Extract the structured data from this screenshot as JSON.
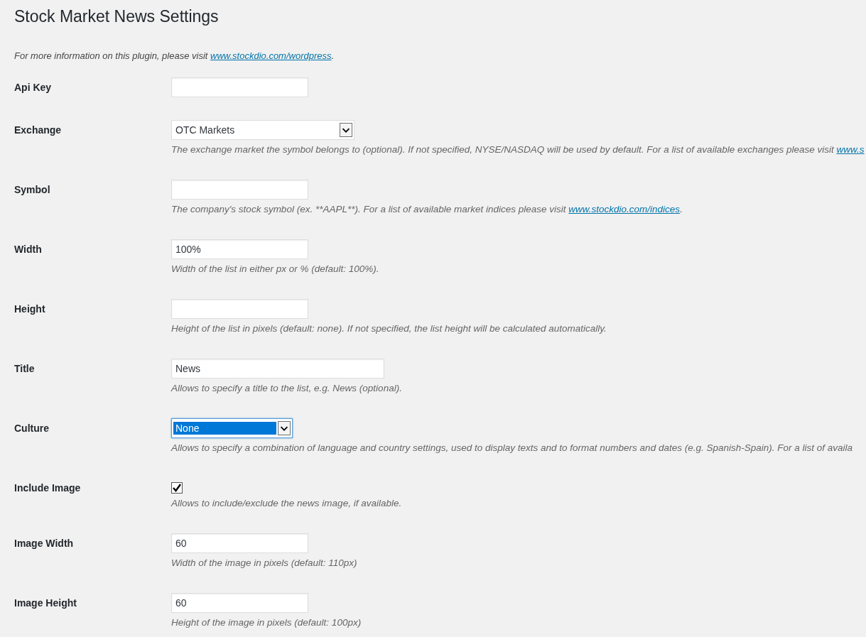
{
  "title": "Stock Market News Settings",
  "intro": {
    "before": "For more information on this plugin, please visit ",
    "link": "www.stockdio.com/wordpress",
    "after": "."
  },
  "settings": [
    {
      "label": "Api Key",
      "kind": "short-text"
    },
    {
      "label": "Exchange",
      "kind": "select",
      "value": "OTC Markets",
      "focused": false,
      "description": {
        "before": "The exchange market the symbol belongs to (optional). If not specified, NYSE/NASDAQ will be used by default. For a list of available exchanges please visit ",
        "link": "www.s"
      }
    },
    {
      "label": "Symbol",
      "kind": "short-text",
      "description": {
        "before": "The company's stock symbol (ex. **AAPL**). For a list of available market indices please visit ",
        "link": "www.stockdio.com/indices",
        "after": "."
      }
    },
    {
      "label": "Width",
      "kind": "short-text",
      "value": "100%",
      "description": {
        "before": "Width of the list in either px or % (default: 100%)."
      }
    },
    {
      "label": "Height",
      "kind": "short-text",
      "description": {
        "before": "Height of the list in pixels (default: none). If not specified, the list height will be calculated automatically."
      }
    },
    {
      "label": "Title",
      "kind": "long-text",
      "value": "News",
      "description": {
        "before": "Allows to specify a title to the list, e.g. News (optional)."
      }
    },
    {
      "label": "Culture",
      "kind": "select",
      "value": "None",
      "focused": true,
      "description": {
        "before": "Allows to specify a combination of language and country settings, used to display texts and to format numbers and dates (e.g. Spanish-Spain). For a list of availa"
      }
    },
    {
      "label": "Include Image",
      "kind": "checkbox",
      "checked": true,
      "description": {
        "before": "Allows to include/exclude the news image, if available."
      }
    },
    {
      "label": "Image Width",
      "kind": "short-text",
      "value": "60",
      "description": {
        "before": "Width of the image in pixels (default: 110px)"
      }
    },
    {
      "label": "Image Height",
      "kind": "short-text",
      "value": "60",
      "description": {
        "before": "Height of the image in pixels (default: 100px)"
      }
    }
  ]
}
